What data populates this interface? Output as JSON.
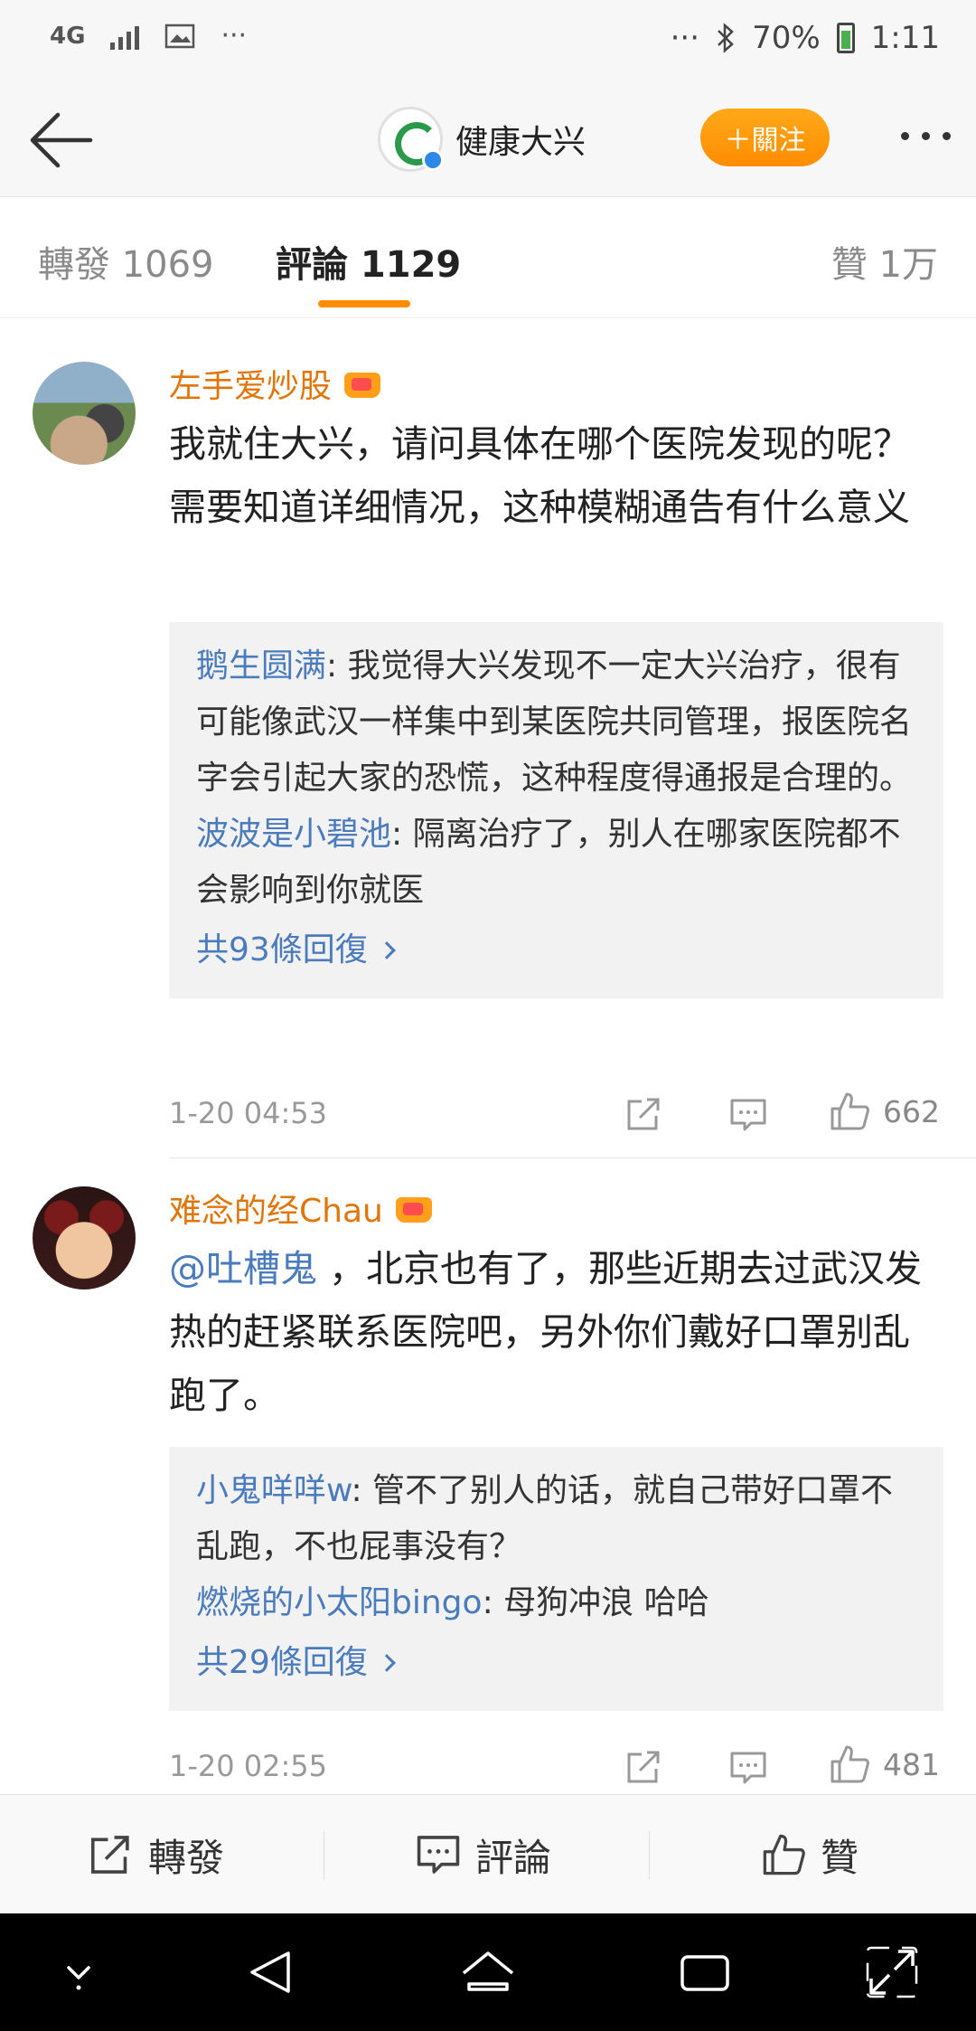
{
  "status_bar": {
    "network": "4G",
    "more": "···",
    "right_more": "···",
    "battery": "70%",
    "time": "1:11"
  },
  "nav": {
    "account_name": "健康大兴",
    "follow_label": "＋關注"
  },
  "tabs": {
    "repost": "轉發 1069",
    "comments": "評論 1129",
    "likes": "贊 1万"
  },
  "comments": [
    {
      "username": "左手爱炒股",
      "text": "我就住大兴，请问具体在哪个医院发现的呢？需要知道详细情况，这种模糊通告有什么意义",
      "replies": [
        {
          "user": "鹅生圆满",
          "text": ": 我觉得大兴发现不一定大兴治疗，很有可能像武汉一样集中到某医院共同管理，报医院名字会引起大家的恐慌，这种程度得通报是合理的。"
        },
        {
          "user": "波波是小碧池",
          "text": ": 隔离治疗了，别人在哪家医院都不会影响到你就医"
        }
      ],
      "more_replies": "共93條回復",
      "time": "1-20 04:53",
      "likes": "662"
    },
    {
      "username": "难念的经Chau",
      "mention": "@吐槽鬼",
      "text": " ，北京也有了，那些近期去过武汉发热的赶紧联系医院吧，另外你们戴好口罩别乱跑了。",
      "replies": [
        {
          "user": "小鬼咩咩w",
          "text": ": 管不了别人的话，就自己带好口罩不乱跑，不也屁事没有？"
        },
        {
          "user": "燃烧的小太阳bingo",
          "text": ": 母狗冲浪 哈哈"
        }
      ],
      "more_replies": "共29條回復",
      "time": "1-20 02:55",
      "likes": "481"
    }
  ],
  "bottom_bar": {
    "repost": "轉發",
    "comment": "評論",
    "like": "贊"
  },
  "colors": {
    "accent_orange": "#ff8c00",
    "username_orange": "#e0760a",
    "link_blue": "#4a7bbd"
  }
}
